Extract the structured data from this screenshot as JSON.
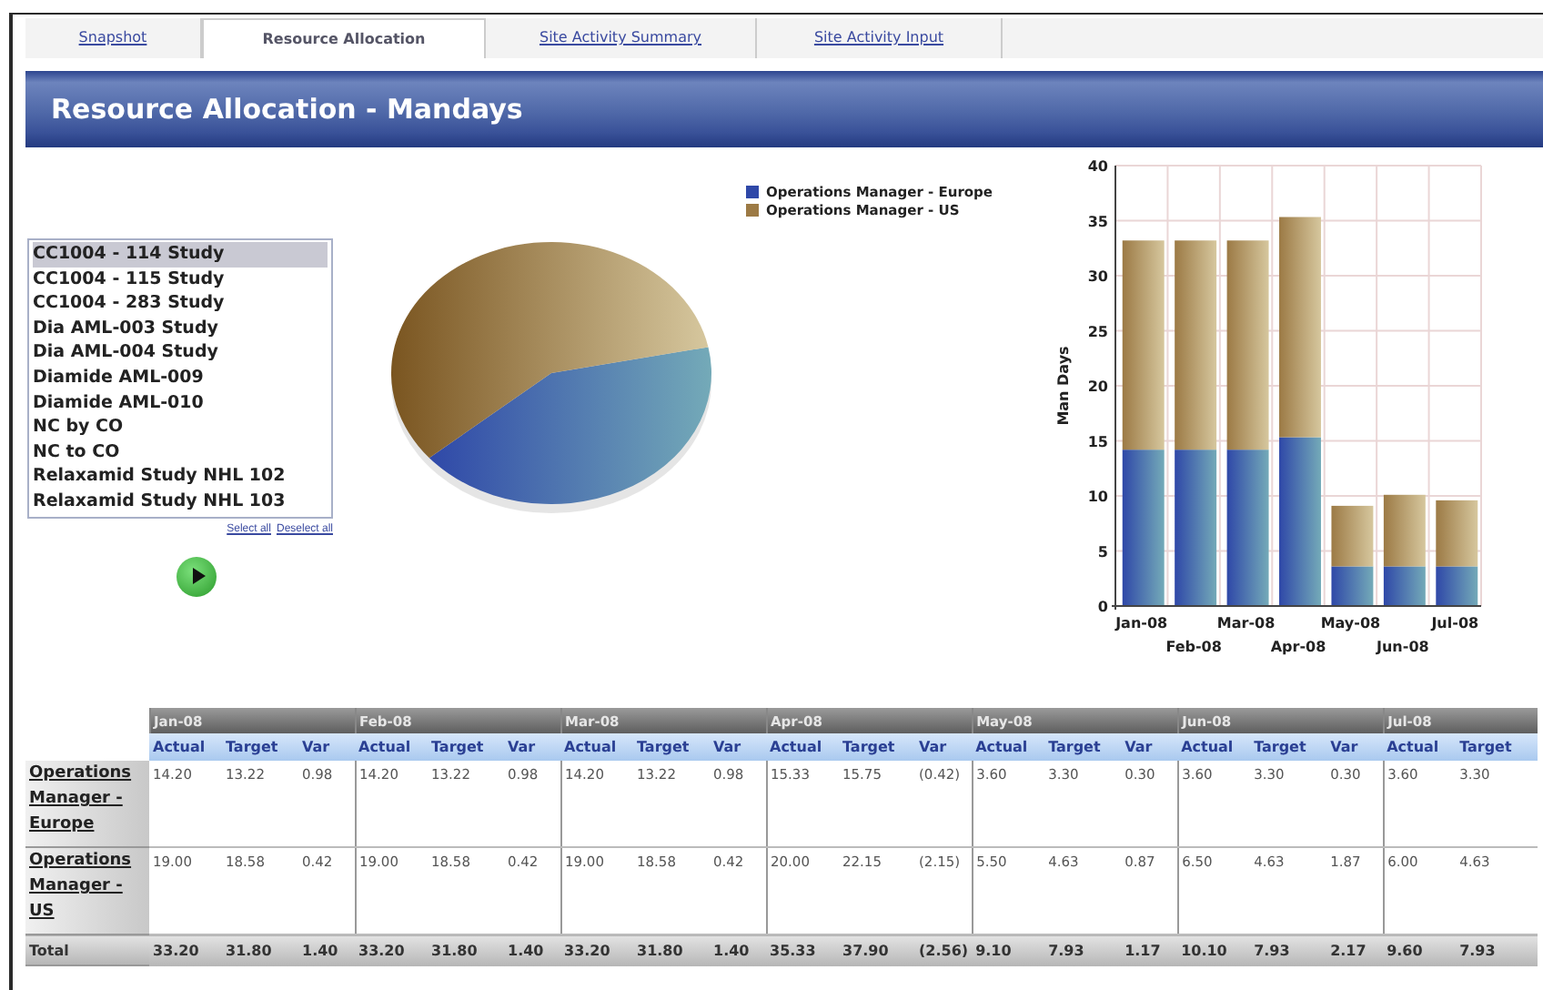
{
  "tabs": [
    {
      "label": "Snapshot",
      "selected": false
    },
    {
      "label": "Resource Allocation",
      "selected": true
    },
    {
      "label": "Site Activity Summary",
      "selected": false
    },
    {
      "label": "Site Activity Input",
      "selected": false
    }
  ],
  "title": "Resource Allocation - Mandays",
  "study_list": {
    "items": [
      {
        "label": "CC1004 - 114 Study",
        "selected": true
      },
      {
        "label": "CC1004 - 115 Study",
        "selected": false
      },
      {
        "label": "CC1004 - 283 Study",
        "selected": false
      },
      {
        "label": "Dia AML-003 Study",
        "selected": false
      },
      {
        "label": "Dia AML-004 Study",
        "selected": false
      },
      {
        "label": "Diamide AML-009",
        "selected": false
      },
      {
        "label": "Diamide AML-010",
        "selected": false
      },
      {
        "label": "NC by CO",
        "selected": false
      },
      {
        "label": "NC to CO",
        "selected": false
      },
      {
        "label": "Relaxamid Study NHL 102",
        "selected": false
      },
      {
        "label": "Relaxamid Study NHL 103",
        "selected": false
      }
    ],
    "links": [
      "Select all",
      "Deselect all"
    ]
  },
  "chart_data": {
    "type": "bar",
    "stacked": true,
    "grid": true,
    "ylabel": "Man Days",
    "categories": [
      "Jan-08",
      "Feb-08",
      "Mar-08",
      "Apr-08",
      "May-08",
      "Jun-08",
      "Jul-08"
    ],
    "series": [
      {
        "name": "Operations Manager - Europe",
        "color": "#2f48a8",
        "values": [
          14.2,
          14.2,
          14.2,
          15.33,
          3.6,
          3.6,
          3.6
        ]
      },
      {
        "name": "Operations Manager - US",
        "color": "#9c7a45",
        "values": [
          19,
          19,
          19,
          20,
          5.5,
          6.5,
          6
        ]
      }
    ],
    "ylim": [
      0,
      40
    ],
    "yticks": [
      0,
      5,
      10,
      15,
      20,
      25,
      30,
      35,
      40
    ]
  },
  "table": {
    "months": [
      {
        "label": "Jan-08",
        "columns": [
          "Actual",
          "Target",
          "Var"
        ]
      },
      {
        "label": "Feb-08",
        "columns": [
          "Actual",
          "Target",
          "Var"
        ]
      },
      {
        "label": "Mar-08",
        "columns": [
          "Actual",
          "Target",
          "Var"
        ]
      },
      {
        "label": "Apr-08",
        "columns": [
          "Actual",
          "Target",
          "Var"
        ]
      },
      {
        "label": "May-08",
        "columns": [
          "Actual",
          "Target",
          "Var"
        ]
      },
      {
        "label": "Jun-08",
        "columns": [
          "Actual",
          "Target",
          "Var"
        ]
      },
      {
        "label": "Jul-08",
        "columns": [
          "Actual",
          "Target"
        ]
      }
    ],
    "rows": [
      {
        "label": "Operations Manager - Europe",
        "kind": "data",
        "values": [
          [
            "14.20",
            "13.22",
            "0.98"
          ],
          [
            "14.20",
            "13.22",
            "0.98"
          ],
          [
            "14.20",
            "13.22",
            "0.98"
          ],
          [
            "15.33",
            "15.75",
            "(0.42)"
          ],
          [
            "3.60",
            "3.30",
            "0.30"
          ],
          [
            "3.60",
            "3.30",
            "0.30"
          ],
          [
            "3.60",
            "3.30"
          ]
        ]
      },
      {
        "label": "Operations Manager - US",
        "kind": "data",
        "values": [
          [
            "19.00",
            "18.58",
            "0.42"
          ],
          [
            "19.00",
            "18.58",
            "0.42"
          ],
          [
            "19.00",
            "18.58",
            "0.42"
          ],
          [
            "20.00",
            "22.15",
            "(2.15)"
          ],
          [
            "5.50",
            "4.63",
            "0.87"
          ],
          [
            "6.50",
            "4.63",
            "1.87"
          ],
          [
            "6.00",
            "4.63"
          ]
        ]
      },
      {
        "label": "Total",
        "kind": "total",
        "values": [
          [
            "33.20",
            "31.80",
            "1.40"
          ],
          [
            "33.20",
            "31.80",
            "1.40"
          ],
          [
            "33.20",
            "31.80",
            "1.40"
          ],
          [
            "35.33",
            "37.90",
            "(2.56)"
          ],
          [
            "9.10",
            "7.93",
            "1.17"
          ],
          [
            "10.10",
            "7.93",
            "2.17"
          ],
          [
            "9.60",
            "7.93"
          ]
        ]
      }
    ]
  }
}
